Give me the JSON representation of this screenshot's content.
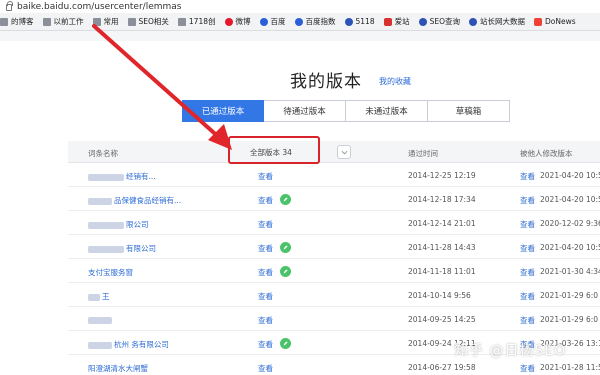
{
  "address_bar": {
    "url": "baike.baidu.com/usercenter/lemmas"
  },
  "bookmarks": [
    {
      "label": "的博客",
      "icon": "folder-icon"
    },
    {
      "label": "以前工作",
      "icon": "folder-icon"
    },
    {
      "label": "常用",
      "icon": "folder-icon"
    },
    {
      "label": "SEO相关",
      "icon": "folder-icon"
    },
    {
      "label": "1718创",
      "icon": "folder-icon"
    },
    {
      "label": "微博",
      "icon": "weibo-icon"
    },
    {
      "label": "百度",
      "icon": "baidu-icon"
    },
    {
      "label": "百度指数",
      "icon": "baidu-icon"
    },
    {
      "label": "5118",
      "icon": "paw-icon"
    },
    {
      "label": "爱站",
      "icon": "red-icon"
    },
    {
      "label": "SEO查询",
      "icon": "paw-icon"
    },
    {
      "label": "站长网大数据",
      "icon": "paw-icon"
    },
    {
      "label": "DoNews",
      "icon": "donews-icon"
    }
  ],
  "page": {
    "title": "我的版本",
    "collection_link": "我的收藏"
  },
  "tabs": [
    {
      "label": "已通过版本",
      "active": true
    },
    {
      "label": "待通过版本",
      "active": false
    },
    {
      "label": "未通过版本",
      "active": false
    },
    {
      "label": "草稿箱",
      "active": false
    }
  ],
  "table": {
    "headers": {
      "entry_name": "词条名称",
      "version_filter": "全部版本 34",
      "passed_time": "通过时间",
      "modified_by_others": "被他人修改版本"
    },
    "rows": [
      {
        "name": "经销有...",
        "name_redacted_width": 3,
        "view": "查看",
        "edited": false,
        "passed_time": "2014-12-25 12:19",
        "mod_view": "查看",
        "mod_date": "2021-04-20 10:5"
      },
      {
        "name": "品保健食品经销有...",
        "name_redacted_width": 2,
        "view": "查看",
        "edited": true,
        "passed_time": "2014-12-18 17:34",
        "mod_view": "查看",
        "mod_date": "2021-04-20 10:5"
      },
      {
        "name": "限公司",
        "name_redacted_width": 3,
        "view": "查看",
        "edited": false,
        "passed_time": "2014-12-14 21:01",
        "mod_view": "查看",
        "mod_date": "2020-12-02 9:36"
      },
      {
        "name": "有限公司",
        "name_redacted_width": 3,
        "view": "查看",
        "edited": true,
        "passed_time": "2014-11-28 14:43",
        "mod_view": "查看",
        "mod_date": "2021-04-20 10:5"
      },
      {
        "name": "支付宝服务窗",
        "name_redacted_width": 0,
        "view": "查看",
        "edited": true,
        "passed_time": "2014-11-18 11:01",
        "mod_view": "查看",
        "mod_date": "2021-01-30 4:34"
      },
      {
        "name": "王",
        "name_redacted_width": 1,
        "view": "查看",
        "edited": false,
        "passed_time": "2014-10-14 9:56",
        "mod_view": "查看",
        "mod_date": "2021-01-29 6:0"
      },
      {
        "name": "",
        "name_redacted_width": 2,
        "view": "查看",
        "edited": false,
        "passed_time": "2014-09-25 14:25",
        "mod_view": "查看",
        "mod_date": "2021-01-29 6:0"
      },
      {
        "name": "杭州 务有限公司",
        "name_redacted_width": 2,
        "view": "查看",
        "edited": true,
        "passed_time": "2014-09-24 12:11",
        "mod_view": "查看",
        "mod_date": "2021-03-26 13:1"
      },
      {
        "name": "阳澄湖清水大闸蟹",
        "name_redacted_width": 0,
        "view": "查看",
        "edited": false,
        "passed_time": "2014-06-27 19:58",
        "mod_view": "查看",
        "mod_date": "2021-01-28 11:5"
      }
    ]
  },
  "annotation": {
    "arrow_color": "#e0262b",
    "box_color": "#d8232a"
  },
  "watermark": "知乎 @日杨SEO",
  "colors": {
    "accent": "#3377e6",
    "link": "#2b6bd6",
    "edit_badge": "#4cc26a"
  }
}
